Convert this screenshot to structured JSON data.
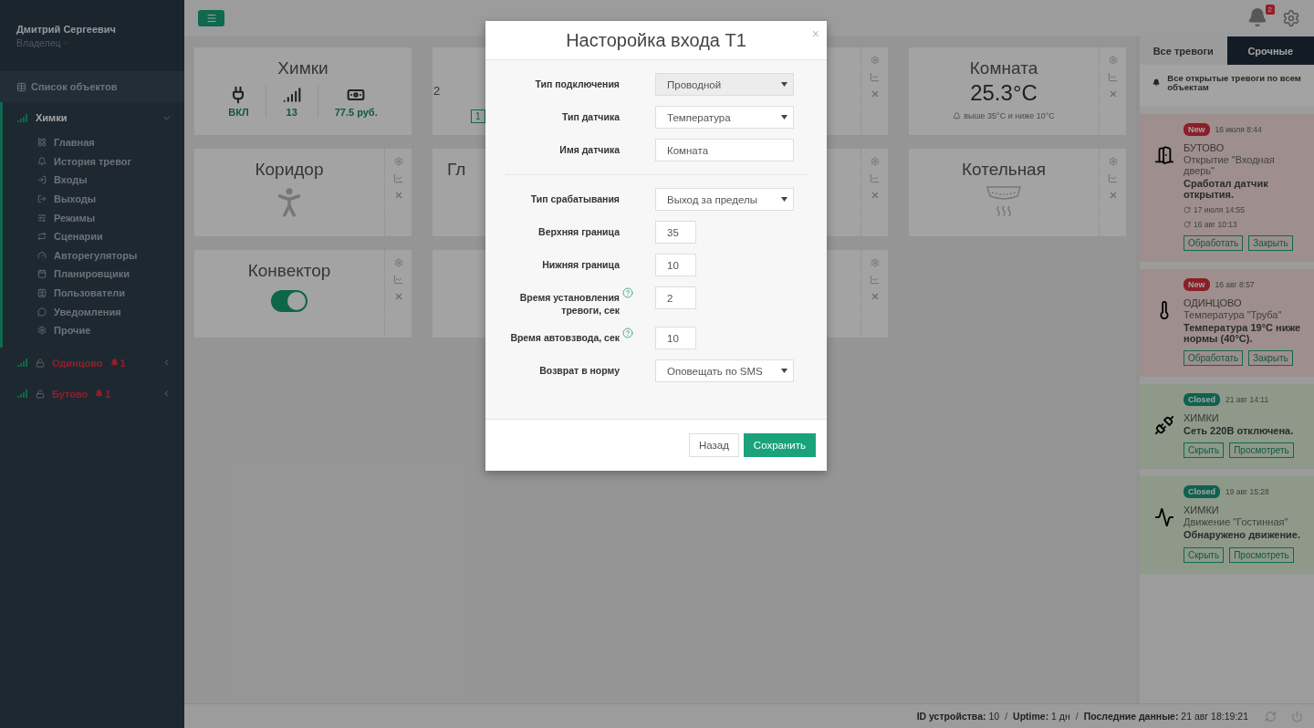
{
  "sidebar": {
    "user_name": "Дмитрий Сергеевич",
    "role": "Владелец",
    "objects_link": "Список объектов",
    "objects": [
      {
        "name": "Химки",
        "expanded": true,
        "alarm": false,
        "children": [
          {
            "label": "Главная"
          },
          {
            "label": "История тревог"
          },
          {
            "label": "Входы"
          },
          {
            "label": "Выходы"
          },
          {
            "label": "Режимы"
          },
          {
            "label": "Сценарии"
          },
          {
            "label": "Авторегуляторы"
          },
          {
            "label": "Планировщики"
          },
          {
            "label": "Пользователи"
          },
          {
            "label": "Уведомления"
          },
          {
            "label": "Прочие"
          }
        ]
      },
      {
        "name": "Одинцово",
        "expanded": false,
        "alarm": true,
        "alarm_count": "1"
      },
      {
        "name": "Бутово",
        "expanded": false,
        "alarm": true,
        "alarm_count": "1"
      }
    ]
  },
  "topbar": {
    "notifications": "2"
  },
  "cards": [
    {
      "kind": "summary",
      "title": "Химки",
      "stats": [
        {
          "value": "ВКЛ"
        },
        {
          "value": "13"
        },
        {
          "value": "77.5 руб."
        }
      ]
    },
    {
      "kind": "obscured",
      "value": "2",
      "badge": "1"
    },
    {
      "kind": "obscured"
    },
    {
      "kind": "temperature",
      "title": "Комната",
      "value": "25.3°C",
      "note": "выше 35°C и ниже 10°C"
    },
    {
      "kind": "motion",
      "title": "Коридор"
    },
    {
      "kind": "obscured",
      "title": "Гл"
    },
    {
      "kind": "obscured"
    },
    {
      "kind": "smoke",
      "title": "Котельная"
    },
    {
      "kind": "switch",
      "title": "Конвектор",
      "on": true
    },
    {
      "kind": "obscured"
    },
    {
      "kind": "obscured"
    }
  ],
  "alerts_panel": {
    "tabs": [
      {
        "label": "Все тревоги",
        "selected": false
      },
      {
        "label": "Срочные",
        "selected": true
      }
    ],
    "info": "Все открытые тревоги по всем объектам",
    "alerts": [
      {
        "kind": "new",
        "badge": "New",
        "time": "16 июля 8:44",
        "place": "БУТОВО",
        "title": "Открытие \"Входная дверь\"",
        "message": "Сработал датчик открытия.",
        "history": [
          "17 июля 14:55",
          "16 авг 10:13"
        ],
        "buttons": [
          "Обработать",
          "Закрыть"
        ]
      },
      {
        "kind": "new",
        "badge": "New",
        "time": "16 авг 8:57",
        "place": "ОДИНЦОВО",
        "title": "Температура \"Труба\"",
        "message": "Температура 19°C ниже нормы (40°C).",
        "buttons": [
          "Обработать",
          "Закрыть"
        ]
      },
      {
        "kind": "closed",
        "badge": "Closed",
        "time": "21 авг 14:11",
        "place": "ХИМКИ",
        "message": "Сеть 220В отключена.",
        "buttons": [
          "Скрыть",
          "Просмотреть"
        ]
      },
      {
        "kind": "closed",
        "badge": "Closed",
        "time": "19 авг 15:28",
        "place": "ХИМКИ",
        "title": "Движение \"Гостинная\"",
        "message": "Обнаружено движение.",
        "buttons": [
          "Скрыть",
          "Просмотреть"
        ]
      }
    ]
  },
  "status_bar": [
    {
      "label": "ID устройства:",
      "value": "10"
    },
    {
      "separator": "/",
      "label": "Uptime:",
      "value": "1 дн"
    },
    {
      "separator": "/",
      "label": "Последние данные:",
      "value": "21 авг 18:19:21"
    }
  ],
  "modal": {
    "title": "Насторойка входа Т1",
    "close": "×",
    "groups": [
      [
        {
          "label": "Тип подключения",
          "kind": "select",
          "value": "Проводной",
          "disabled": true
        },
        {
          "label": "Тип датчика",
          "kind": "select",
          "value": "Температура",
          "disabled": false
        },
        {
          "label": "Имя датчика",
          "kind": "text",
          "value": "Комната",
          "disabled": false
        }
      ],
      [
        {
          "label": "Тип срабатывания",
          "kind": "select",
          "value": "Выход за пределы",
          "disabled": false
        },
        {
          "label": "Верхняя граница",
          "kind": "number",
          "value": "35",
          "disabled": false
        },
        {
          "label": "Нижняя граница",
          "kind": "number",
          "value": "10",
          "disabled": false
        },
        {
          "label": "Время установления тревоги, сек",
          "kind": "number",
          "value": "2",
          "disabled": false,
          "help": true
        },
        {
          "label": "Время автовзвода, сек",
          "kind": "number",
          "value": "10",
          "disabled": false,
          "help": true
        },
        {
          "label": "Возврат в норму",
          "kind": "select",
          "value": "Оповещать по SMS",
          "disabled": false
        }
      ]
    ],
    "buttons": [
      {
        "label": "Назад",
        "kind": "default"
      },
      {
        "label": "Сохранить",
        "kind": "primary"
      }
    ]
  }
}
